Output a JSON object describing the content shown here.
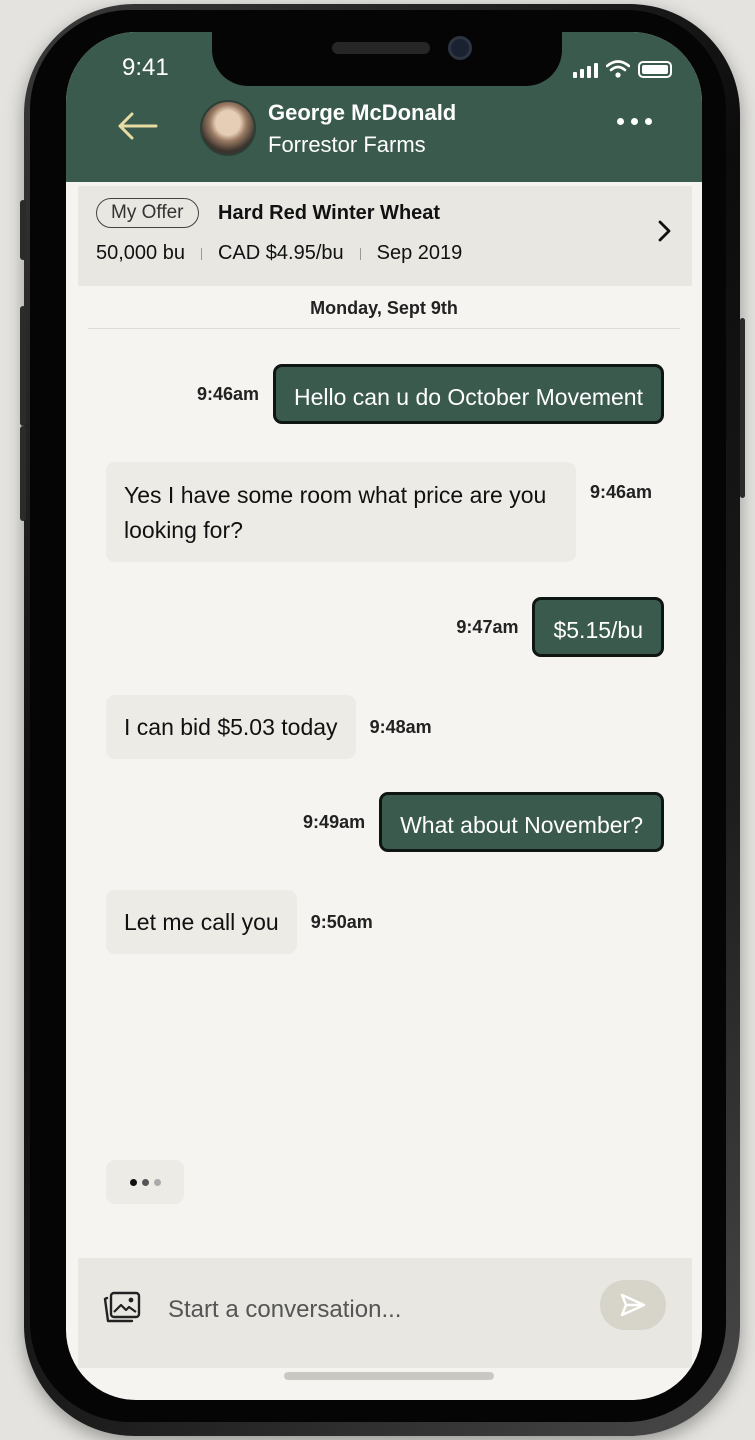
{
  "status_bar": {
    "time": "9:41"
  },
  "header": {
    "contact_name": "George McDonald",
    "company": "Forrestor Farms",
    "colors": {
      "bar": "#3b5a4e"
    }
  },
  "offer": {
    "badge": "My Offer",
    "product": "Hard Red Winter Wheat",
    "quantity": "50,000 bu",
    "price": "CAD $4.95/bu",
    "date": "Sep 2019"
  },
  "date_divider": "Monday, Sept 9th",
  "messages": [
    {
      "direction": "out",
      "text": "Hello can u do October Movement",
      "time": "9:46am"
    },
    {
      "direction": "in",
      "text": "Yes I have some room what price are you looking for?",
      "time": "9:46am"
    },
    {
      "direction": "out",
      "text": "$5.15/bu",
      "time": "9:47am"
    },
    {
      "direction": "in",
      "text": "I can bid $5.03 today",
      "time": "9:48am"
    },
    {
      "direction": "out",
      "text": "What about November?",
      "time": "9:49am"
    },
    {
      "direction": "in",
      "text": "Let me call you",
      "time": "9:50am"
    }
  ],
  "composer": {
    "placeholder": "Start a conversation..."
  },
  "icons": {
    "back": "arrow-left-icon",
    "more": "more-horizontal-icon",
    "chevron": "chevron-right-icon",
    "image": "image-icon",
    "send": "send-icon"
  }
}
